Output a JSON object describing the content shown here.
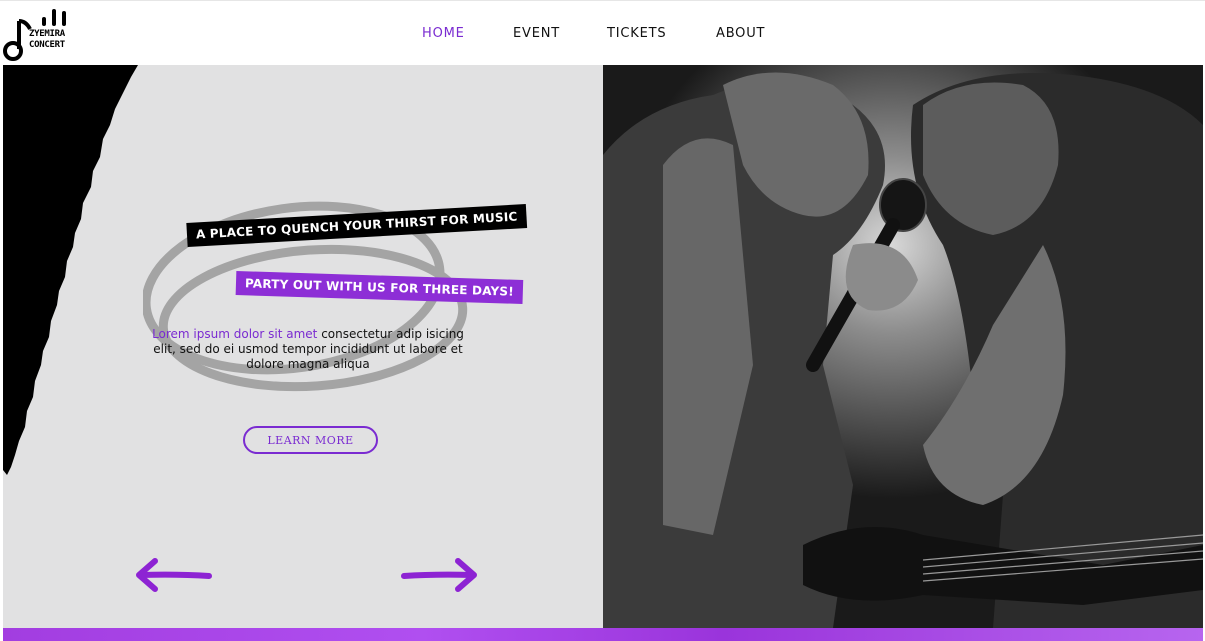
{
  "brand": {
    "logo_line1": "ZYEMIRA",
    "logo_line2": "CONCERT",
    "accent": "#7a2bd1"
  },
  "nav": {
    "items": [
      {
        "label": "HOME",
        "active": true
      },
      {
        "label": "EVENT",
        "active": false
      },
      {
        "label": "TICKETS",
        "active": false
      },
      {
        "label": "ABOUT",
        "active": false
      }
    ]
  },
  "hero": {
    "tagline": "A PLACE TO QUENCH YOUR THIRST FOR MUSIC",
    "subtagline": "PARTY OUT WITH US FOR THREE DAYS!",
    "body_highlight": "Lorem ipsum dolor sit amet",
    "body_rest": " consectetur adip isicing elit, sed do ei usmod tempor incididunt ut labore et dolore magna aliqua",
    "cta_label": "LEARN MORE",
    "prev_icon": "arrow-left-icon",
    "next_icon": "arrow-right-icon"
  },
  "photo": {
    "subject": "concert-singers-photo"
  }
}
